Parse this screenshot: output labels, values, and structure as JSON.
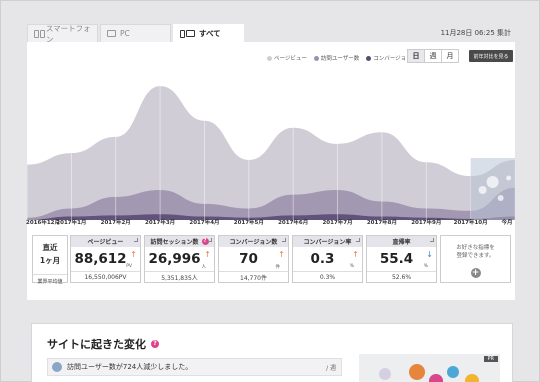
{
  "tabs": [
    {
      "label": "スマートフォン",
      "icon": "smartphone-icon",
      "active": false
    },
    {
      "label": "PC",
      "icon": "pc-icon",
      "active": false
    },
    {
      "label": "すべて",
      "icon": "all-devices-icon",
      "active": true
    }
  ],
  "header": {
    "date": "11月28日 06:25 集計"
  },
  "legend": [
    {
      "label": "ページビュー",
      "color": "#d0cdd6"
    },
    {
      "label": "訪問ユーザー数",
      "color": "#9d92ad"
    },
    {
      "label": "コンバージョン数",
      "color": "#5a4a75"
    }
  ],
  "period_toggles": [
    {
      "label": "日",
      "selected": true
    },
    {
      "label": "週",
      "selected": false
    },
    {
      "label": "月",
      "selected": false
    }
  ],
  "compare_button": "前年対比を見る",
  "chart_data": {
    "type": "area",
    "x": [
      "2016年12月",
      "2017年1月",
      "2017年2月",
      "2017年3月",
      "2017年4月",
      "2017年5月",
      "2017年6月",
      "2017年7月",
      "2017年8月",
      "2017年9月",
      "2017年10月",
      "今月"
    ],
    "series": [
      {
        "name": "ページビュー",
        "color": "#d0cdd6",
        "values": [
          48,
          58,
          72,
          116,
          86,
          52,
          80,
          66,
          76,
          50,
          38,
          52
        ]
      },
      {
        "name": "訪問ユーザー数",
        "color": "#9d92ad",
        "values": [
          2,
          10,
          20,
          26,
          14,
          10,
          22,
          26,
          16,
          10,
          8,
          28
        ]
      },
      {
        "name": "コンバージョン数",
        "color": "#5a4a75",
        "values": [
          0,
          3,
          4,
          5,
          3,
          2,
          4,
          5,
          3,
          2,
          1,
          3
        ]
      }
    ],
    "ylim": [
      0,
      130
    ],
    "grid": true,
    "highlight_last": true
  },
  "kpi_side": {
    "line1": "直近",
    "line2": "1ヶ月",
    "line3": "業界平均値"
  },
  "kpis": [
    {
      "label": "ページビュー",
      "value": "88,612",
      "unit": "PV",
      "trend": "up",
      "sub": "16,550,006PV",
      "help": false
    },
    {
      "label": "訪問セッション数",
      "value": "26,996",
      "unit": "人",
      "trend": "up",
      "sub": "5,351,835人",
      "help": true
    },
    {
      "label": "コンバージョン数",
      "value": "70",
      "unit": "件",
      "trend": "up",
      "sub": "14,770件",
      "help": false
    },
    {
      "label": "コンバージョン率",
      "value": "0.3",
      "unit": "%",
      "trend": "up",
      "sub": "0.3%",
      "help": false
    },
    {
      "label": "直帰率",
      "value": "55.4",
      "unit": "%",
      "trend": "down",
      "sub": "52.6%",
      "help": false
    }
  ],
  "kpi_add": {
    "line1": "お好きな指標を",
    "line2": "登録できます。",
    "icon": "plus-icon"
  },
  "changes_section": {
    "title": "サイトに起きた変化",
    "item": {
      "text": "訪問ユーザー数が724人減少しました。",
      "meta": "/ 週"
    },
    "ad_tag": "PR"
  }
}
